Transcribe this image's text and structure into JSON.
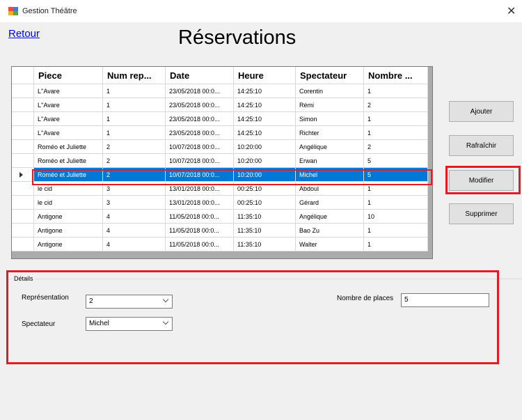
{
  "window": {
    "title": "Gestion Théâtre",
    "close_glyph": "✕"
  },
  "nav": {
    "back_label": "Retour"
  },
  "page": {
    "title": "Réservations"
  },
  "grid": {
    "columns": [
      "Piece",
      "Num rep...",
      "Date",
      "Heure",
      "Spectateur",
      "Nombre ..."
    ],
    "selected_row": 6,
    "rows": [
      [
        "L''Avare",
        "1",
        "23/05/2018 00:0...",
        "14:25:10",
        "Corentin",
        "1"
      ],
      [
        "L''Avare",
        "1",
        "23/05/2018 00:0...",
        "14:25:10",
        "Rémi",
        "2"
      ],
      [
        "L''Avare",
        "1",
        "23/05/2018 00:0...",
        "14:25:10",
        "Simon",
        "1"
      ],
      [
        "L''Avare",
        "1",
        "23/05/2018 00:0...",
        "14:25:10",
        "Richter",
        "1"
      ],
      [
        "Roméo et Juliette",
        "2",
        "10/07/2018 00:0...",
        "10:20:00",
        "Angélique",
        "2"
      ],
      [
        "Roméo et Juliette",
        "2",
        "10/07/2018 00:0...",
        "10:20:00",
        "Erwan",
        "5"
      ],
      [
        "Roméo et Juliette",
        "2",
        "10/07/2018 00:0...",
        "10:20:00",
        "Michel",
        "5"
      ],
      [
        "le cid",
        "3",
        "13/01/2018 00:0...",
        "00:25:10",
        "Abdoul",
        "1"
      ],
      [
        "le cid",
        "3",
        "13/01/2018 00:0...",
        "00:25:10",
        "Gérard",
        "1"
      ],
      [
        "Antigone",
        "4",
        "11/05/2018 00:0...",
        "11:35:10",
        "Angélique",
        "10"
      ],
      [
        "Antigone",
        "4",
        "11/05/2018 00:0...",
        "11:35:10",
        "Bao Zu",
        "1"
      ],
      [
        "Antigone",
        "4",
        "11/05/2018 00:0...",
        "11:35:10",
        "Walter",
        "1"
      ]
    ]
  },
  "actions": {
    "add_label": "Ajouter",
    "refresh_label": "Rafraîchir",
    "edit_label": "Modifier",
    "delete_label": "Supprimer"
  },
  "details": {
    "legend": "Détails",
    "representation_label": "Représentation",
    "representation_value": "2",
    "spectateur_label": "Spectateur",
    "spectateur_value": "Michel",
    "places_label": "Nombre de places",
    "places_value": "5"
  },
  "colors": {
    "selection": "#0078d7",
    "highlight": "#e31b23"
  }
}
